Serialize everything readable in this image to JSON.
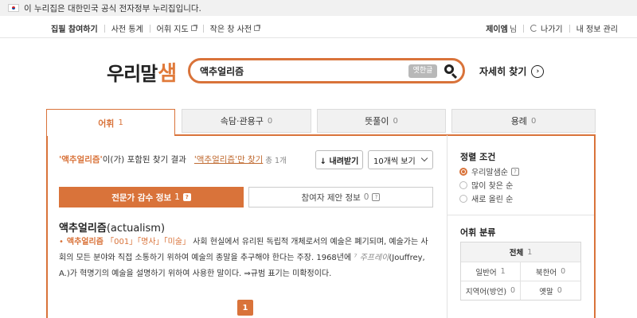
{
  "gov_banner": {
    "text": "이 누리집은 대한민국 공식 전자정부 누리집입니다."
  },
  "topnav": {
    "left": [
      "집필 참여하기",
      "사전 통계",
      "어휘 지도",
      "작은 창 사전"
    ],
    "user_name": "제이엠",
    "user_suffix": "님",
    "logout": "나가기",
    "my_info": "내 정보 관리"
  },
  "logo": {
    "main": "우리말",
    "accent": "샘"
  },
  "search": {
    "query": "액추얼리즘",
    "old_hangul_label": "옛한글"
  },
  "advanced_search": {
    "label": "자세히 찾기"
  },
  "tabs": [
    {
      "label": "어휘",
      "count": "1"
    },
    {
      "label": "속담·관용구",
      "count": "0"
    },
    {
      "label": "뜻풀이",
      "count": "0"
    },
    {
      "label": "용례",
      "count": "0"
    }
  ],
  "result_header": {
    "keyword_quoted": "'액추얼리즘'",
    "contains_text": "이(가) 포함된 찾기 결과",
    "exact_link": "'액추얼리즘'만 찾기",
    "total": "총 1개"
  },
  "toolbar": {
    "download": "↓ 내려받기",
    "view_count": "10개씩 보기"
  },
  "subtabs": {
    "expert": {
      "label": "전문가 감수 정보",
      "count": "1",
      "q": "?"
    },
    "contrib": {
      "label": "참여자 제안 정보",
      "count": "0",
      "q": "?"
    }
  },
  "entry": {
    "headword": "액추얼리즘",
    "origin": "(actualism)",
    "bullet": "•",
    "hw_inline": "액추얼리즘",
    "cat1": "「001」",
    "cat2": "「명사」",
    "cat3": "「미술」",
    "def1": " 사회 현실에서 유리된 독립적 개체로서의 예술은 폐기되며, 예술가는 사회의 모든 분야와 직접 소통하기 위하여 예술의 종말을 추구해야 한다는 주장. 1968년에 ",
    "source": "⁷ 주프레이",
    "def2": "(Jouffrey, A.)가 혁명기의 예술을 설명하기 위하여 사용한 말이다. ⇒규범 표기는 미확정이다."
  },
  "pagination": {
    "current": "1"
  },
  "sort": {
    "title": "정렬 조건",
    "options": [
      {
        "label": "우리말샘순",
        "selected": true,
        "help": "?"
      },
      {
        "label": "많이 찾은 순",
        "selected": false
      },
      {
        "label": "새로 올린 순",
        "selected": false
      }
    ]
  },
  "classification": {
    "title": "어휘 분류",
    "all": {
      "label": "전체",
      "count": "1"
    },
    "items": [
      {
        "label": "일반어",
        "count": "1"
      },
      {
        "label": "북한어",
        "count": "0"
      },
      {
        "label": "지역어(방언)",
        "count": "0"
      },
      {
        "label": "옛말",
        "count": "0"
      }
    ]
  },
  "colors": {
    "accent": "#d9733a",
    "text": "#222222",
    "muted": "#888888"
  }
}
